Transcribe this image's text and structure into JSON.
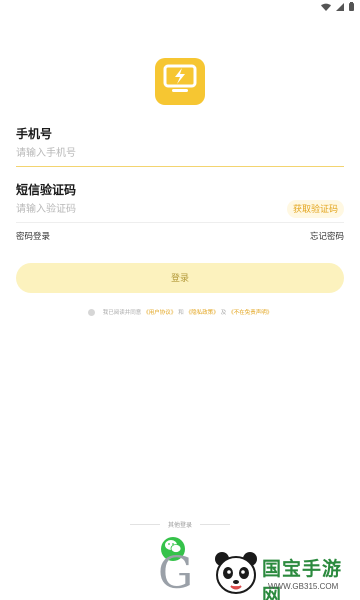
{
  "status_bar": {
    "icons": [
      "wifi-icon",
      "cellular-signal-icon",
      "battery-icon"
    ]
  },
  "logo": {
    "icon": "monitor-lightning-icon",
    "color": "#f6c632"
  },
  "phone": {
    "label": "手机号",
    "placeholder": "请输入手机号"
  },
  "sms": {
    "label": "短信验证码",
    "placeholder": "请输入验证码",
    "get_code_label": "获取验证码"
  },
  "links": {
    "password_login": "密码登录",
    "forgot_password": "忘记密码"
  },
  "login_button": {
    "label": "登录"
  },
  "agreement": {
    "prefix": "我已阅读并同意",
    "user_agreement": "《用户协议》",
    "and1": "和",
    "privacy_policy": "《隐私政策》",
    "and2": "及",
    "disclaimer": "《不在免责声明》"
  },
  "other_login": {
    "label": "其他登录",
    "icon": "wechat-icon"
  },
  "watermark": {
    "letter": "G",
    "title": "国宝手游网",
    "url": "WWW.GB315.COM"
  },
  "colors": {
    "accent": "#f6c632",
    "link": "#e3a51f",
    "button_bg": "#fcf2be",
    "wechat": "#35c24a"
  }
}
